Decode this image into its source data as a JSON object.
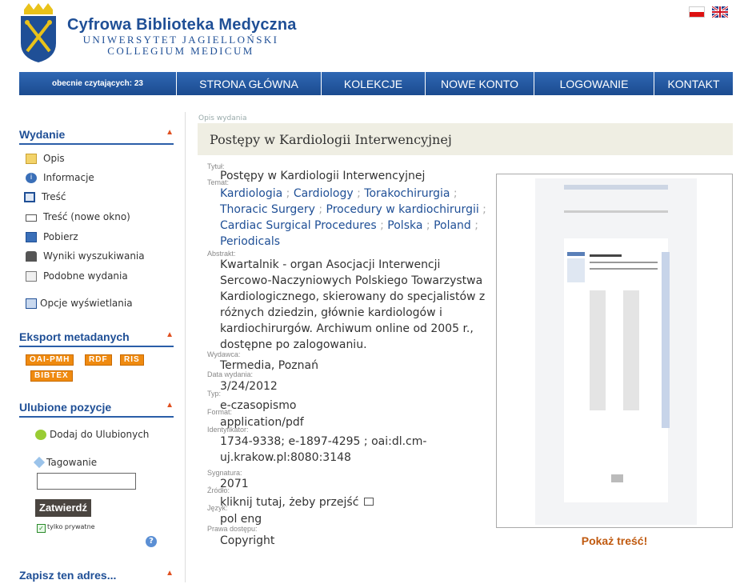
{
  "header": {
    "brand_title": "Cyfrowa Biblioteka Medyczna",
    "brand_sub1": "UNIWERSYTET JAGIELLOŃSKI",
    "brand_sub2": "COLLEGIUM MEDICUM"
  },
  "nav": {
    "readers": "obecnie czytających: 23",
    "items": [
      "STRONA GŁÓWNA",
      "KOLEKCJE",
      "NOWE KONTO",
      "LOGOWANIE",
      "KONTAKT"
    ]
  },
  "sidebar": {
    "wydanie_title": "Wydanie",
    "wydanie_items": [
      "Opis",
      "Informacje",
      "Treść",
      "Treść (nowe okno)",
      "Pobierz",
      "Wyniki wyszukiwania",
      "Podobne wydania"
    ],
    "display_options": "Opcje wyświetlania",
    "export_title": "Eksport metadanych",
    "export_badges": [
      "OAI-PMH",
      "RDF",
      "RIS",
      "BIBTEX"
    ],
    "fav_title": "Ulubione pozycje",
    "add_fav": "Dodaj do Ulubionych",
    "tagging": "Tagowanie",
    "submit": "Zatwierdź",
    "private": "tylko prywatne",
    "save_title": "Zapisz ten adres..."
  },
  "main": {
    "breadcrumb": "Opis wydania",
    "page_title": "Postępy w Kardiologii Interwencyjnej",
    "labels": {
      "title": "Tytuł:",
      "subject": "Temat:",
      "abstract": "Abstrakt:",
      "publisher": "Wydawca:",
      "date": "Data wydania:",
      "type": "Typ:",
      "format": "Format:",
      "identifier": "Identyfikator:",
      "signature": "Sygnatura:",
      "source": "Źródło:",
      "language": "Język:",
      "rights": "Prawa dostępu:"
    },
    "values": {
      "title": "Postępy w Kardiologii Interwencyjnej",
      "subjects": [
        "Kardiologia",
        "Cardiology",
        "Torakochirurgia",
        "Thoracic Surgery",
        "Procedury w kardiochirurgii",
        "Cardiac Surgical Procedures",
        "Polska",
        "Poland",
        "Periodicals"
      ],
      "abstract": "Kwartalnik - organ Asocjacji Interwencji Sercowo-Naczyniowych Polskiego Towarzystwa Kardiologicznego, skierowany do specjalistów z różnych dziedzin, głównie kardiologów i kardiochirurgów. Archiwum online od 2005 r., dostępne po zalogowaniu.",
      "publisher": "Termedia, Poznań",
      "date": "3/24/2012",
      "type": "e-czasopismo",
      "format": "application/pdf",
      "identifier": "1734-9338; e-1897-4295 ; oai:dl.cm-uj.krakow.pl:8080:3148",
      "signature": "2071",
      "source": "kliknij tutaj, żeby przejść",
      "language": "pol eng",
      "rights": "Copyright"
    },
    "show_content": "Pokaż treść!"
  }
}
